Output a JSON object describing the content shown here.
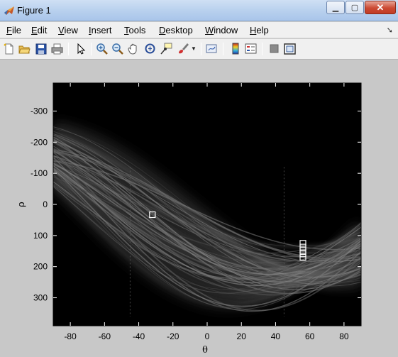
{
  "window": {
    "title": "Figure 1"
  },
  "menu": [
    {
      "label": "File",
      "u": "F",
      "rest": "ile",
      "name": "menu-file"
    },
    {
      "label": "Edit",
      "u": "E",
      "rest": "dit",
      "name": "menu-edit"
    },
    {
      "label": "View",
      "u": "V",
      "rest": "iew",
      "name": "menu-view"
    },
    {
      "label": "Insert",
      "u": "I",
      "rest": "nsert",
      "name": "menu-insert"
    },
    {
      "label": "Tools",
      "u": "T",
      "rest": "ools",
      "name": "menu-tools"
    },
    {
      "label": "Desktop",
      "u": "D",
      "rest": "esktop",
      "name": "menu-desktop"
    },
    {
      "label": "Window",
      "u": "W",
      "rest": "indow",
      "name": "menu-window"
    },
    {
      "label": "Help",
      "u": "H",
      "rest": "elp",
      "name": "menu-help"
    }
  ],
  "toolbar": [
    "new-figure-icon",
    "open-file-icon",
    "save-icon",
    "print-icon",
    "edit-plot-icon",
    "zoom-in-icon",
    "zoom-out-icon",
    "pan-icon",
    "rotate-3d-icon",
    "data-cursor-icon",
    "brush-icon",
    "link-plot-icon",
    "insert-colorbar-icon",
    "insert-legend-icon",
    "hide-plot-tools-icon",
    "show-plot-tools-icon"
  ],
  "chart_data": {
    "type": "heatmap",
    "title": "",
    "xlabel": "θ",
    "ylabel": "ρ",
    "xlim": [
      -90,
      90
    ],
    "ylim": [
      -390,
      390
    ],
    "y_reversed": true,
    "colormap": "gray",
    "background": "#000000",
    "xticks": [
      -80,
      -60,
      -40,
      -20,
      0,
      20,
      40,
      60,
      80
    ],
    "yticks": [
      -300,
      -200,
      -100,
      0,
      100,
      200,
      300
    ],
    "peaks": [
      {
        "theta": -32,
        "rho": 33
      },
      {
        "theta": 56,
        "rho": 125
      },
      {
        "theta": 56,
        "rho": 137
      },
      {
        "theta": 56,
        "rho": 148
      },
      {
        "theta": 56,
        "rho": 159
      },
      {
        "theta": 56,
        "rho": 170
      }
    ]
  }
}
